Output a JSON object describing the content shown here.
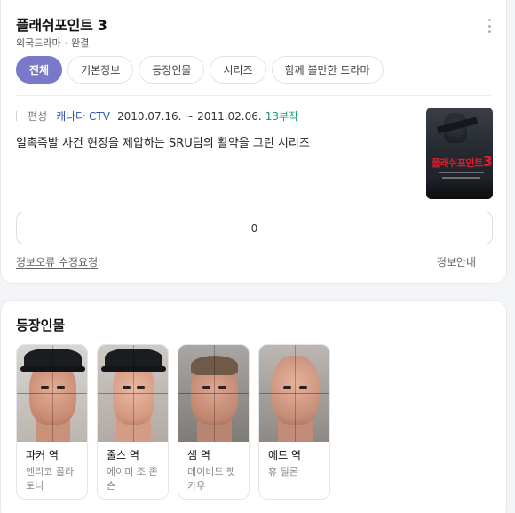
{
  "show": {
    "title": "플래쉬포인트 3",
    "category": "외국드라마",
    "status": "완결"
  },
  "tabs": [
    {
      "label": "전체",
      "active": true
    },
    {
      "label": "기본정보",
      "active": false
    },
    {
      "label": "등장인물",
      "active": false
    },
    {
      "label": "시리즈",
      "active": false
    },
    {
      "label": "함께 볼만한 드라마",
      "active": false
    }
  ],
  "broadcast": {
    "label": "편성",
    "channel": "캐나다 CTV",
    "period": "2010.07.16. ~ 2011.02.06.",
    "episodes": "13부작"
  },
  "description": "일촉즉발 사건 현장을 제압하는 SRU팀의 활약을 그린 시리즈",
  "poster": {
    "title": "플래쉬포인트",
    "number": "3",
    "icon": "poster-image"
  },
  "rating": {
    "value": "0"
  },
  "links": {
    "report": "정보오류 수정요청",
    "info": "정보안내"
  },
  "cast_section": {
    "title": "등장인물",
    "members": [
      {
        "role": "파커 역",
        "actor": "엔리코 콜라토니"
      },
      {
        "role": "줄스 역",
        "actor": "에이미 조 존슨"
      },
      {
        "role": "샘 역",
        "actor": "데이비드 팻카우"
      },
      {
        "role": "에드 역",
        "actor": "휴 딜론"
      }
    ]
  },
  "colors": {
    "accent": "#7a79c9",
    "channel": "#2c4fb3",
    "episodes": "#169c7b",
    "poster_title": "#e21d2b"
  }
}
